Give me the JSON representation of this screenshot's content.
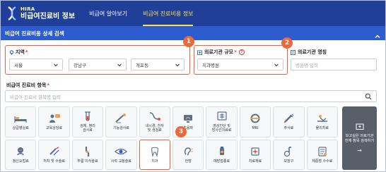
{
  "header": {
    "logo_small": "HIRA",
    "logo_big": "비급여진료비 정보",
    "nav": [
      {
        "label": "비급여 알아보기",
        "active": false
      },
      {
        "label": "비급여 진료비용 정보",
        "active": true
      }
    ]
  },
  "section": {
    "title": "비급여 진료비용 상세 검색"
  },
  "region": {
    "label": "지역",
    "required": "*",
    "sido": "서울",
    "sigungu": "강남구",
    "dong": "개포동"
  },
  "hospital_size": {
    "label": "의료기관 규모",
    "required": "*",
    "value": "치과병원"
  },
  "hospital_name": {
    "label": "의료기관 명칭",
    "placeholder": "병원명 입력"
  },
  "items": {
    "label": "비급여 진료비 항목",
    "required": "*",
    "search_placeholder": "비급여 진료비 항목명 입력",
    "tiles": [
      {
        "label": "상급병실료",
        "icon": "bed-icon"
      },
      {
        "label": "교육상담료",
        "icon": "consult-icon"
      },
      {
        "label": "검체, 병리\n검사료",
        "icon": "test-tube-icon"
      },
      {
        "label": "기능검사료",
        "icon": "function-test-icon"
      },
      {
        "label": "내시경, 천자\n및 생검료",
        "icon": "endoscope-icon"
      },
      {
        "label": "초음파",
        "icon": "ultrasound-icon"
      },
      {
        "label": "영상진단 및\n방사선치료료",
        "icon": "radiology-icon"
      },
      {
        "label": "MRI",
        "icon": "mri-icon"
      },
      {
        "label": "주사료",
        "icon": "syringe-icon"
      },
      {
        "label": "물리치료",
        "icon": "physio-icon"
      },
      {
        "label": "정신요법료",
        "icon": "brain-icon"
      },
      {
        "label": "처치 및 수술료",
        "icon": "surgery-icon"
      },
      {
        "label": "무릎 이식술료",
        "icon": "knee-icon"
      },
      {
        "label": "시력 교정술료",
        "icon": "eye-icon"
      },
      {
        "label": "치과",
        "icon": "tooth-icon",
        "highlight": true
      },
      {
        "label": "한방",
        "icon": "ear-icon"
      },
      {
        "label": "예방접종료",
        "icon": "vaccine-icon"
      },
      {
        "label": "치료재료",
        "icon": "material-icon"
      },
      {
        "label": "보장구",
        "icon": "brace-icon"
      },
      {
        "label": "제증명 수수료",
        "icon": "certificate-icon"
      }
    ]
  },
  "side_button": {
    "label": "보고싶은 의료기관\n전체 항목 검색하기",
    "arrow": "→"
  },
  "callouts": [
    "1",
    "2",
    "3"
  ],
  "colors": {
    "header_bg": "#1f3f98",
    "section_bg": "#2d5bd0",
    "active_nav": "#ffe24a",
    "callout": "#e4623c",
    "required": "#e23b3b",
    "side_button_bg": "#585f68"
  }
}
